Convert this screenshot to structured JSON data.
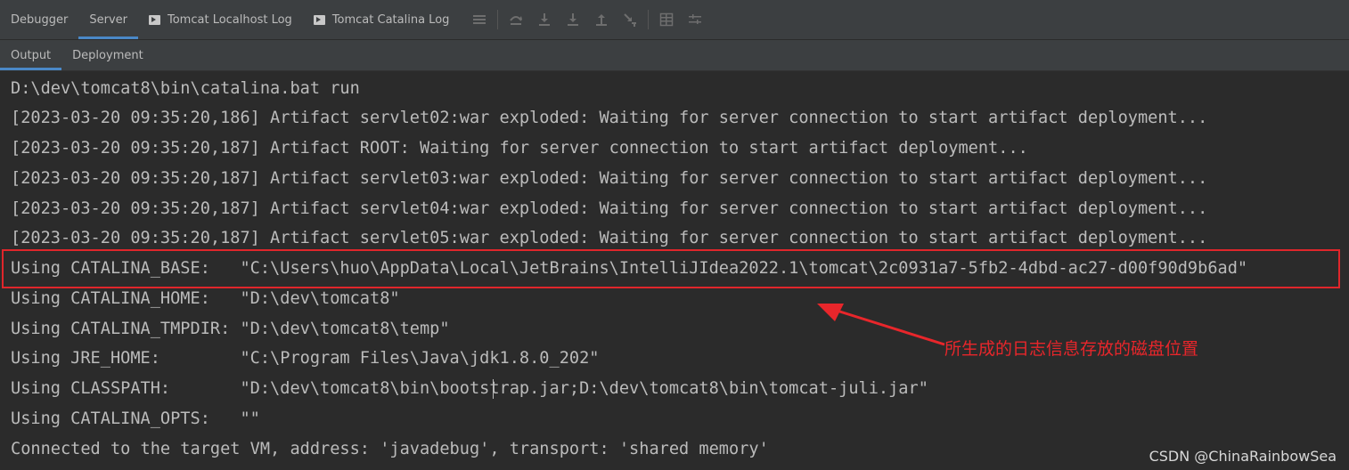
{
  "tabs_top": [
    {
      "label": "Debugger",
      "icon": null,
      "active": false
    },
    {
      "label": "Server",
      "icon": null,
      "active": true
    },
    {
      "label": "Tomcat Localhost Log",
      "icon": "console-tab-icon",
      "active": false
    },
    {
      "label": "Tomcat Catalina Log",
      "icon": "console-tab-icon",
      "active": false
    }
  ],
  "toolbar_icons": [
    "menu-lines-icon",
    "step-over-icon",
    "step-into-icon",
    "force-step-into-icon",
    "step-out-icon",
    "run-to-cursor-icon",
    "evaluate-icon",
    "trace-icon"
  ],
  "tabs_sub": [
    {
      "label": "Output",
      "active": true
    },
    {
      "label": "Deployment",
      "active": false
    }
  ],
  "console_lines": [
    "D:\\dev\\tomcat8\\bin\\catalina.bat run",
    "[2023-03-20 09:35:20,186] Artifact servlet02:war exploded: Waiting for server connection to start artifact deployment...",
    "[2023-03-20 09:35:20,187] Artifact ROOT: Waiting for server connection to start artifact deployment...",
    "[2023-03-20 09:35:20,187] Artifact servlet03:war exploded: Waiting for server connection to start artifact deployment...",
    "[2023-03-20 09:35:20,187] Artifact servlet04:war exploded: Waiting for server connection to start artifact deployment...",
    "[2023-03-20 09:35:20,187] Artifact servlet05:war exploded: Waiting for server connection to start artifact deployment...",
    "Using CATALINA_BASE:   \"C:\\Users\\huo\\AppData\\Local\\JetBrains\\IntelliJIdea2022.1\\tomcat\\2c0931a7-5fb2-4dbd-ac27-d00f90d9b6ad\"",
    "Using CATALINA_HOME:   \"D:\\dev\\tomcat8\"",
    "Using CATALINA_TMPDIR: \"D:\\dev\\tomcat8\\temp\"",
    "Using JRE_HOME:        \"C:\\Program Files\\Java\\jdk1.8.0_202\"",
    "Using CLASSPATH:       \"D:\\dev\\tomcat8\\bin\\bootstrap.jar;D:\\dev\\tomcat8\\bin\\tomcat-juli.jar\"",
    "Using CATALINA_OPTS:   \"\"",
    "Connected to the target VM, address: 'javadebug', transport: 'shared memory'"
  ],
  "annotation": {
    "text": "所生成的日志信息存放的磁盘位置",
    "color": "#e8262b"
  },
  "watermark": "CSDN @ChinaRainbowSea",
  "colors": {
    "background": "#2b2b2b",
    "tabbar": "#3c3f41",
    "accent": "#4a88c7",
    "text": "#bbbbbb",
    "highlight": "#e0262b"
  }
}
